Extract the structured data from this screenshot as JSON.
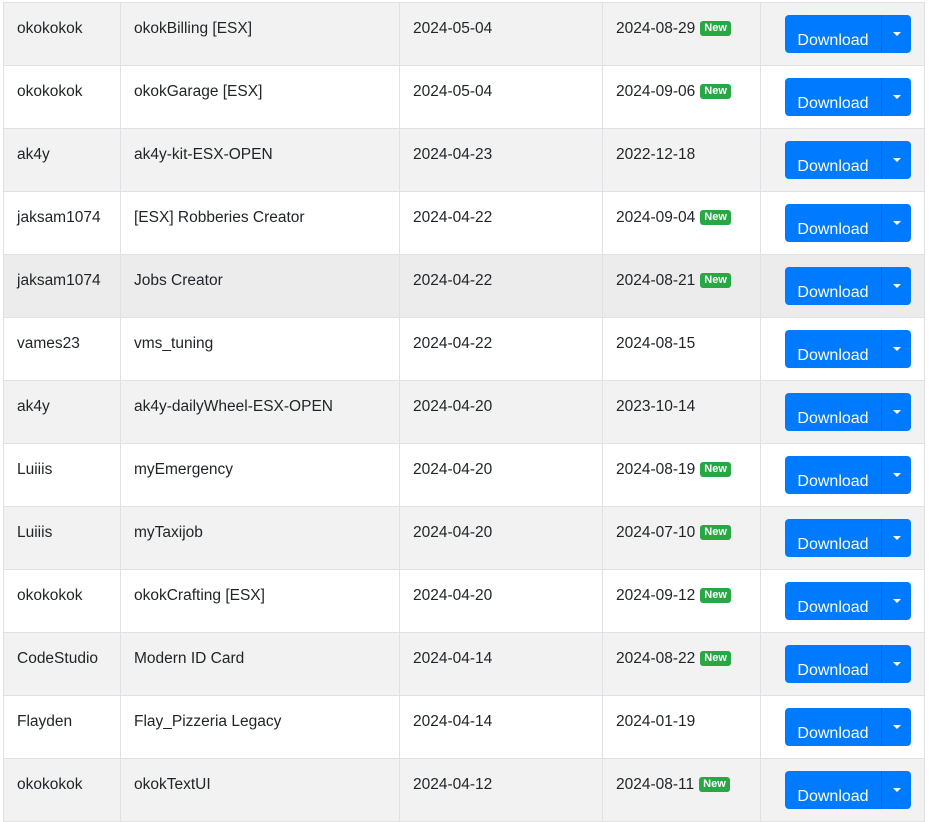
{
  "table": {
    "download_label": "Download",
    "new_badge_label": "New",
    "rows": [
      {
        "author": "okokokok",
        "name": "okokBilling [ESX]",
        "added": "2024-05-04",
        "updated": "2024-08-29",
        "is_new": true
      },
      {
        "author": "okokokok",
        "name": "okokGarage [ESX]",
        "added": "2024-05-04",
        "updated": "2024-09-06",
        "is_new": true
      },
      {
        "author": "ak4y",
        "name": "ak4y-kit-ESX-OPEN",
        "added": "2024-04-23",
        "updated": "2022-12-18",
        "is_new": false
      },
      {
        "author": "jaksam1074",
        "name": "[ESX] Robberies Creator",
        "added": "2024-04-22",
        "updated": "2024-09-04",
        "is_new": true
      },
      {
        "author": "jaksam1074",
        "name": "Jobs Creator",
        "added": "2024-04-22",
        "updated": "2024-08-21",
        "is_new": true
      },
      {
        "author": "vames23",
        "name": "vms_tuning",
        "added": "2024-04-22",
        "updated": "2024-08-15",
        "is_new": false
      },
      {
        "author": "ak4y",
        "name": "ak4y-dailyWheel-ESX-OPEN",
        "added": "2024-04-20",
        "updated": "2023-10-14",
        "is_new": false
      },
      {
        "author": "Luiiis",
        "name": "myEmergency",
        "added": "2024-04-20",
        "updated": "2024-08-19",
        "is_new": true
      },
      {
        "author": "Luiiis",
        "name": "myTaxijob",
        "added": "2024-04-20",
        "updated": "2024-07-10",
        "is_new": true
      },
      {
        "author": "okokokok",
        "name": "okokCrafting [ESX]",
        "added": "2024-04-20",
        "updated": "2024-09-12",
        "is_new": true
      },
      {
        "author": "CodeStudio",
        "name": "Modern ID Card",
        "added": "2024-04-14",
        "updated": "2024-08-22",
        "is_new": true
      },
      {
        "author": "Flayden",
        "name": "Flay_Pizzeria Legacy",
        "added": "2024-04-14",
        "updated": "2024-01-19",
        "is_new": false
      },
      {
        "author": "okokokok",
        "name": "okokTextUI",
        "added": "2024-04-12",
        "updated": "2024-08-11",
        "is_new": true
      }
    ],
    "colors": {
      "button": "#007bff",
      "badge": "#28a745",
      "stripe": "#f2f2f2",
      "hover": "#ececec",
      "border": "#dee2e6"
    },
    "hovered_row": 4
  }
}
